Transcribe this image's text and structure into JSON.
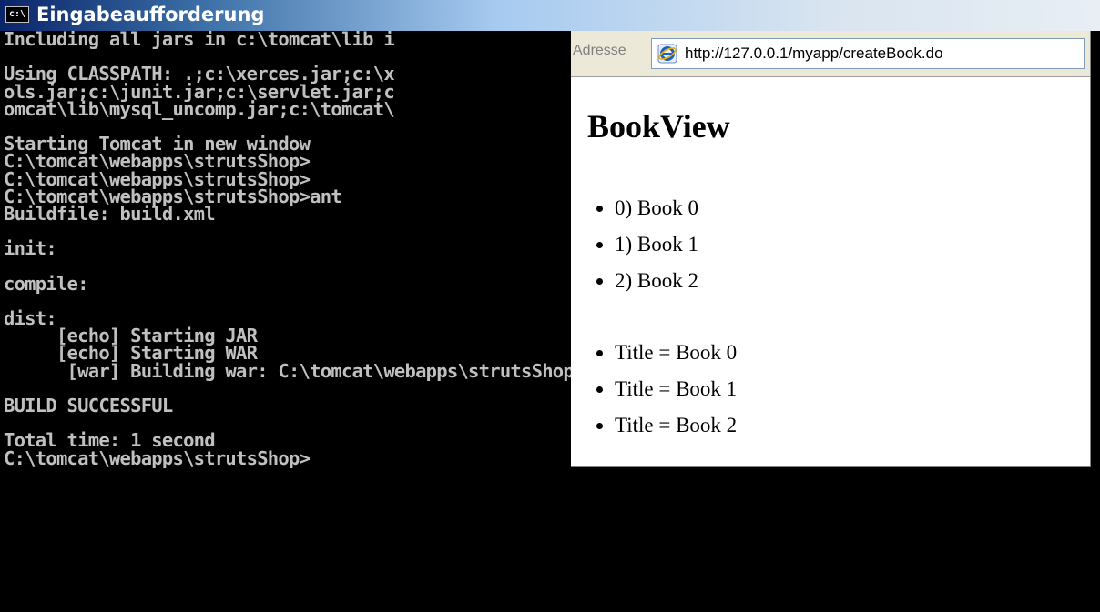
{
  "console_window": {
    "title": "Eingabeaufforderung",
    "icon_text": "c:\\",
    "lines": [
      "Including all jars in c:\\tomcat\\lib i",
      "",
      "Using CLASSPATH: .;c:\\xerces.jar;c:\\x",
      "ols.jar;c:\\junit.jar;c:\\servlet.jar;c",
      "omcat\\lib\\mysql_uncomp.jar;c:\\tomcat\\",
      "",
      "Starting Tomcat in new window",
      "C:\\tomcat\\webapps\\strutsShop>",
      "C:\\tomcat\\webapps\\strutsShop>",
      "C:\\tomcat\\webapps\\strutsShop>ant",
      "Buildfile: build.xml",
      "",
      "init:",
      "",
      "compile:",
      "",
      "dist:",
      "     [echo] Starting JAR",
      "     [echo] Starting WAR",
      "      [war] Building war: C:\\tomcat\\webapps\\strutsShop\\myapp.war",
      "",
      "BUILD SUCCESSFUL",
      "",
      "Total time: 1 second",
      "C:\\tomcat\\webapps\\strutsShop>"
    ]
  },
  "browser": {
    "address_label": "Adresse",
    "url": "http://127.0.0.1/myapp/createBook.do",
    "page": {
      "heading": "BookView",
      "list_a": [
        "0) Book 0",
        "1) Book 1",
        "2) Book 2"
      ],
      "list_b": [
        "Title = Book 0",
        "Title = Book 1",
        "Title = Book 2"
      ]
    }
  },
  "colors": {
    "console_bg": "#000000",
    "console_text": "#c0c0c0",
    "titlebar_start": "#0a246a",
    "browser_bg": "#ffffff",
    "toolbar_bg": "#ece9d8"
  }
}
